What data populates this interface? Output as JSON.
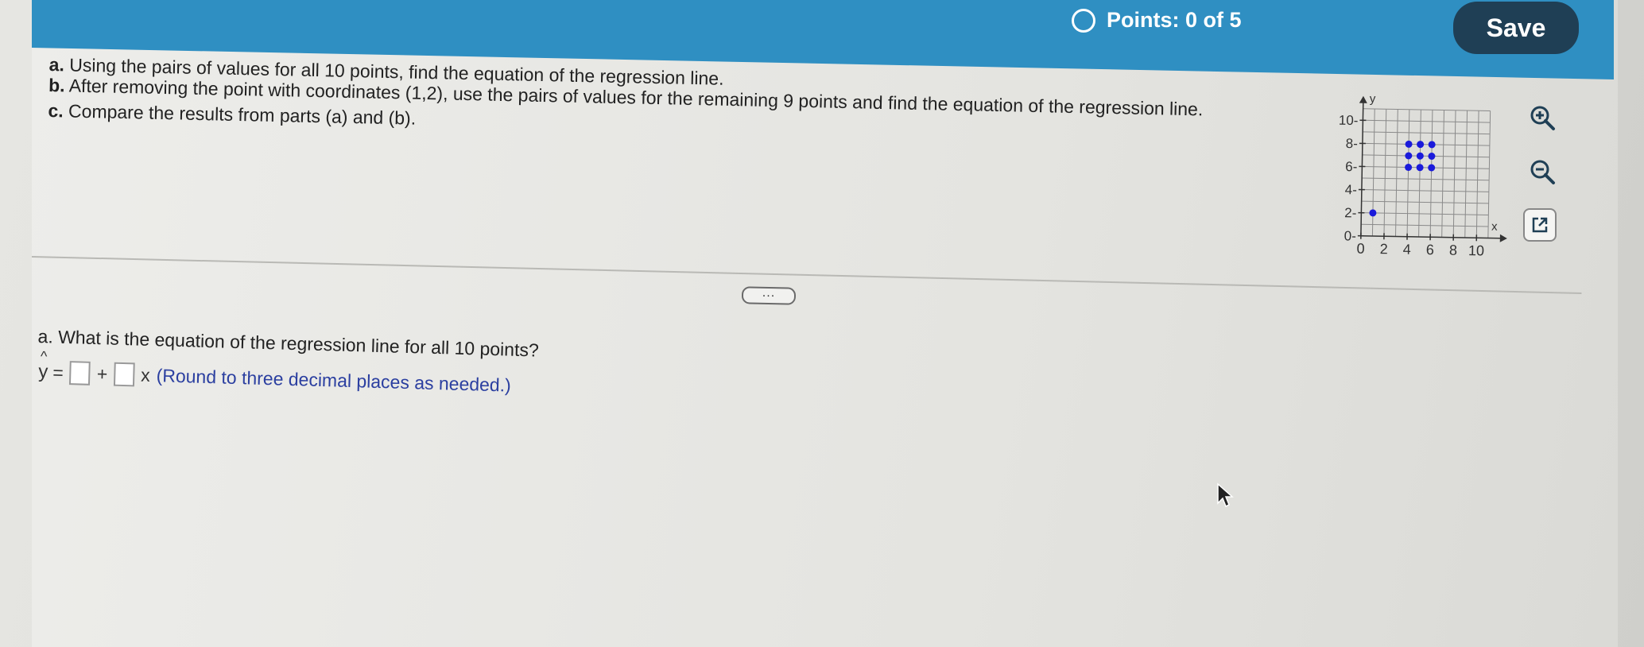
{
  "header": {
    "points_label": "Points: 0 of 5",
    "save_label": "Save"
  },
  "question": {
    "part_a_letter": "a.",
    "part_a": "Using the pairs of values for all 10 points, find the equation of the regression line.",
    "part_b_letter": "b.",
    "part_b": "After removing the point with coordinates (1,2), use the pairs of values for the remaining 9 points and find the equation of the regression line.",
    "part_c_letter": "c.",
    "part_c": "Compare the results from parts (a) and (b)."
  },
  "more_button": "...",
  "answer": {
    "question_text": "a. What is the equation of the regression line for all 10 points?",
    "yhat": "y",
    "hat": "^",
    "equals": "=",
    "plus": "+",
    "x": "x",
    "hint": "(Round to three decimal places as needed.)"
  },
  "tools": {
    "zoom_in": "zoom-in-icon",
    "zoom_out": "zoom-out-icon",
    "popout": "popout-icon"
  },
  "chart_data": {
    "type": "scatter",
    "x": [
      1,
      4,
      4,
      4,
      5,
      5,
      5,
      6,
      6,
      6
    ],
    "y": [
      2,
      6,
      7,
      8,
      6,
      7,
      8,
      6,
      7,
      8
    ],
    "xlabel": "x",
    "ylabel": "y",
    "xlim": [
      0,
      11
    ],
    "ylim": [
      0,
      11
    ],
    "xticks": [
      "0",
      "2",
      "4",
      "6",
      "8",
      "10"
    ],
    "yticks": [
      "0",
      "2",
      "4",
      "6",
      "8",
      "10"
    ],
    "grid": true,
    "point_color": "#1a1adb"
  }
}
